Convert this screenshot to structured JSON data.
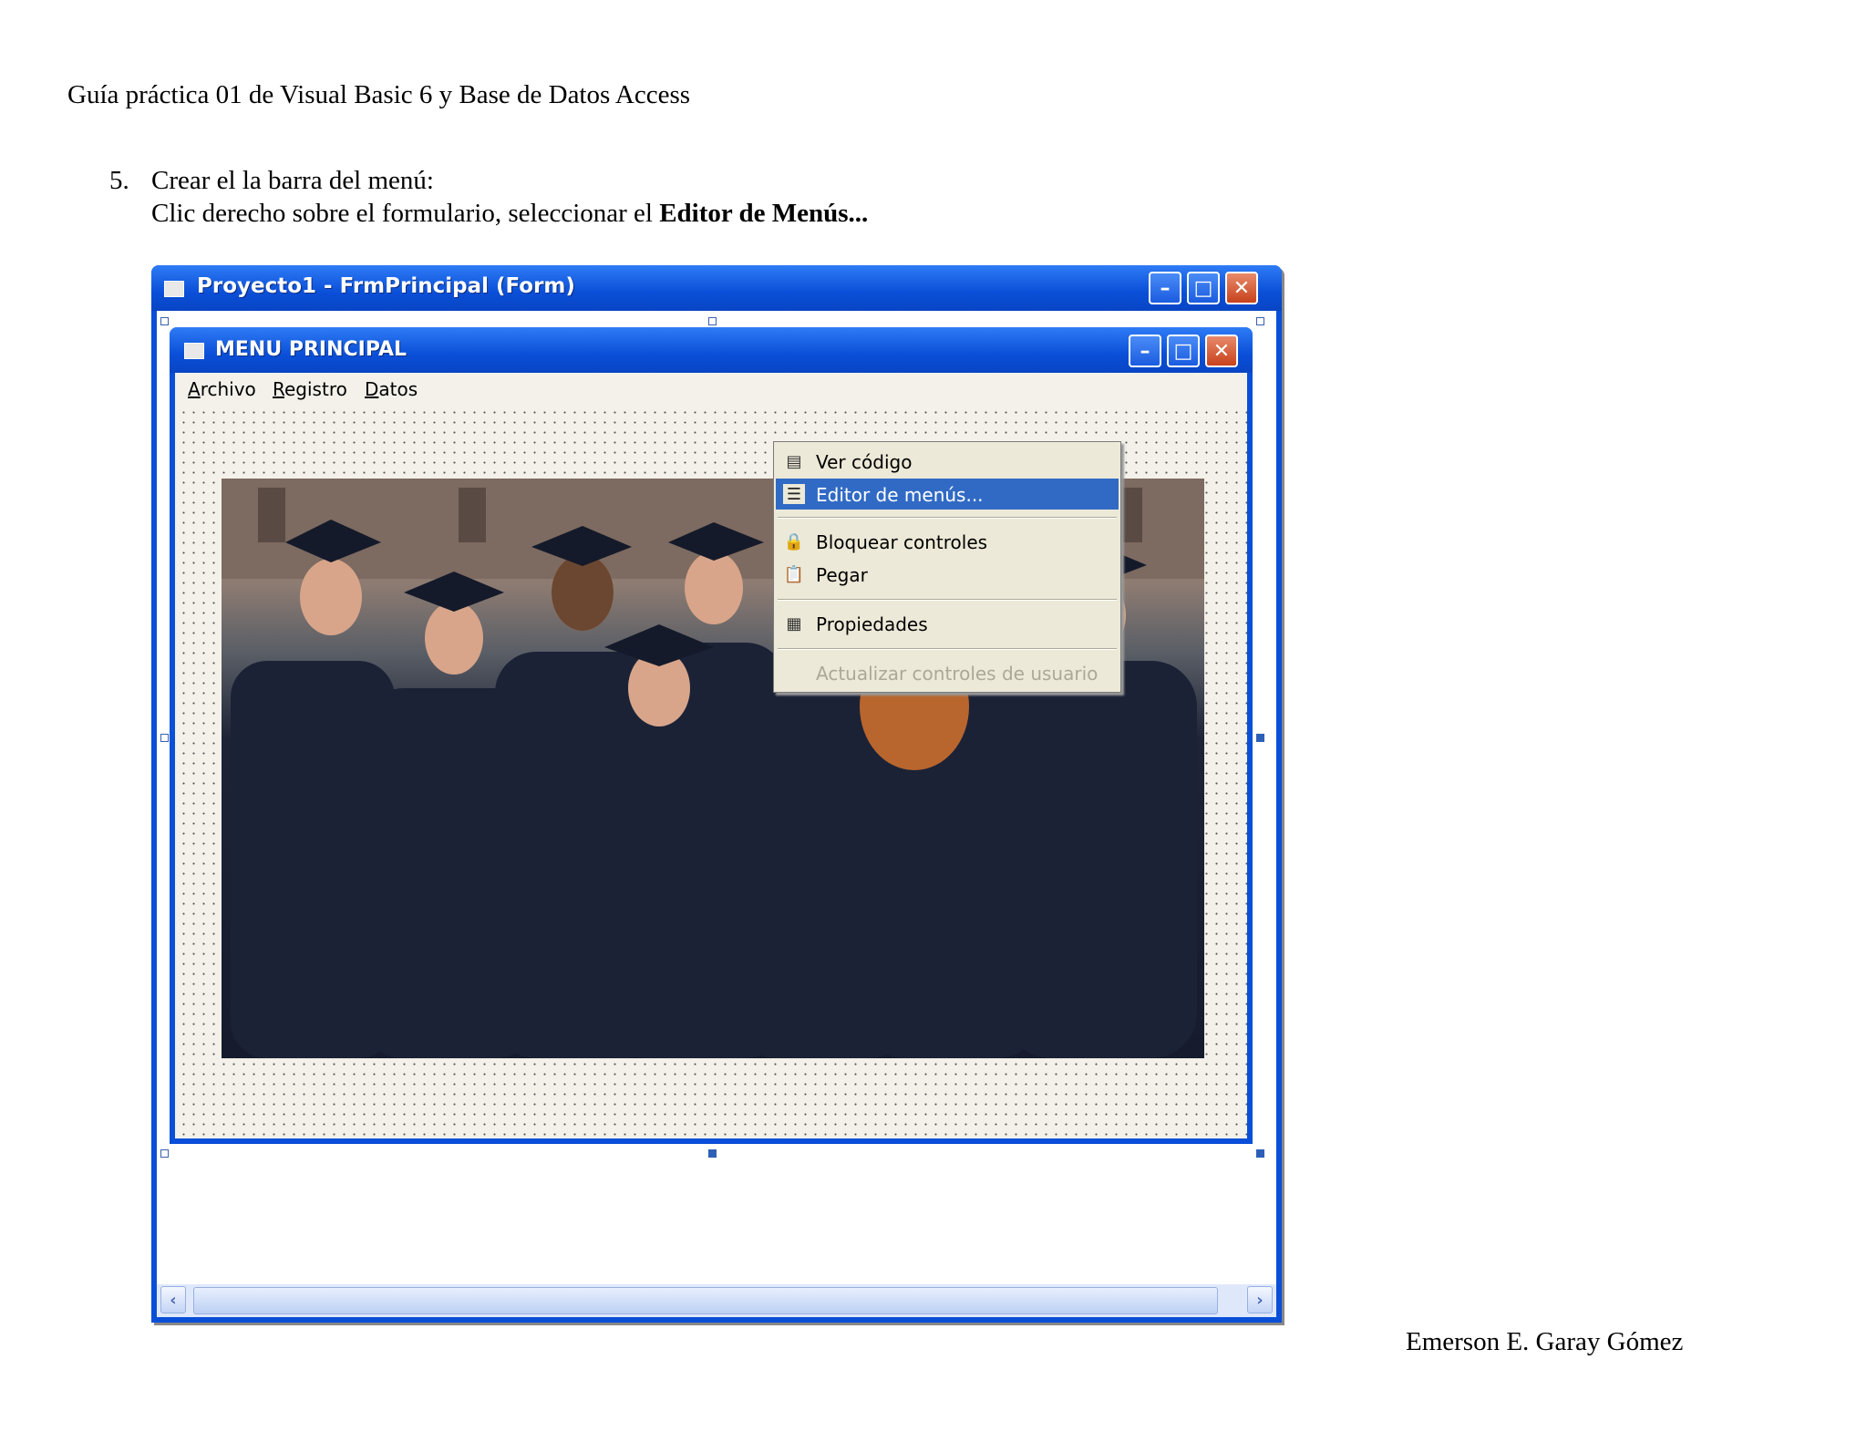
{
  "document": {
    "header": "Guía práctica 01 de Visual Basic 6 y Base de Datos Access",
    "step_number": "5.",
    "step_title": "Crear el la barra del menú:",
    "step_text": "Clic derecho sobre el formulario, seleccionar el ",
    "step_bold": "Editor de Menús...",
    "author": "Emerson E. Garay Gómez"
  },
  "outer_window": {
    "title": "Proyecto1 - FrmPrincipal (Form)"
  },
  "form": {
    "title": "MENU PRINCIPAL",
    "menu": [
      {
        "first": "A",
        "rest": "rchivo"
      },
      {
        "first": "R",
        "rest": "egistro"
      },
      {
        "first": "D",
        "rest": "atos"
      }
    ]
  },
  "context_menu": {
    "items": [
      {
        "label": "Ver código",
        "icon": "view-code-icon",
        "state": "normal"
      },
      {
        "label": "Editor de menús...",
        "icon": "menu-editor-icon",
        "state": "selected"
      },
      {
        "label": "Bloquear controles",
        "icon": "lock-icon",
        "state": "normal"
      },
      {
        "label": "Pegar",
        "icon": "paste-icon",
        "state": "normal"
      },
      {
        "label": "Propiedades",
        "icon": "properties-icon",
        "state": "normal"
      },
      {
        "label": "Actualizar controles de usuario",
        "icon": "",
        "state": "disabled"
      }
    ]
  },
  "colors": {
    "xp_title_blue": "#0a4fd8",
    "selection_blue": "#316ac5",
    "menu_face": "#ece9d8"
  }
}
